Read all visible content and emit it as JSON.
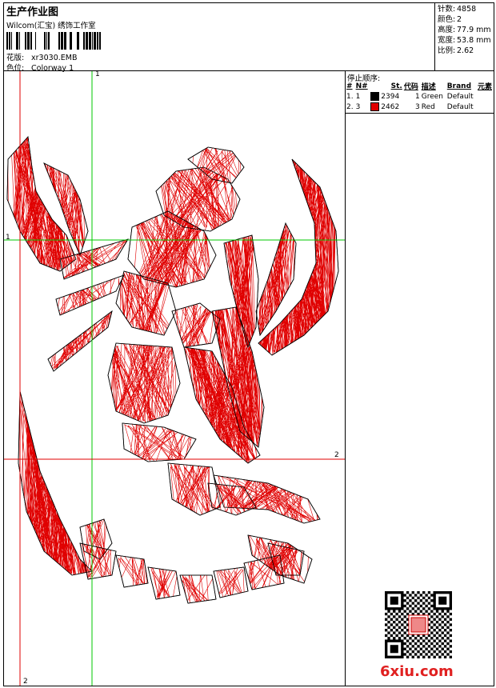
{
  "header": {
    "title": "生产作业图",
    "subtitle": "Wilcom(汇宝) 绣饰工作室",
    "design_label": "花版:",
    "design_value": "xr3030.EMB",
    "colorway_label": "色位:",
    "colorway_value": "Colorway 1"
  },
  "stats": {
    "stitches_label": "针数:",
    "stitches_value": "4858",
    "colors_label": "颜色:",
    "colors_value": "2",
    "height_label": "高度:",
    "height_value": "77.9 mm",
    "width_label": "宽度:",
    "width_value": "53.8 mm",
    "scale_label": "比例:",
    "scale_value": "2.62"
  },
  "stop_sequence": {
    "title": "停止顺序:",
    "columns": [
      "#",
      "N#",
      "St.",
      "代码",
      "描述",
      "Brand",
      "元素"
    ],
    "rows": [
      {
        "index": "1.",
        "needle": "1",
        "stitches": "2394",
        "code": "1",
        "description": "Green",
        "brand": "Default",
        "color": "#000000"
      },
      {
        "index": "2.",
        "needle": "3",
        "stitches": "2462",
        "code": "3",
        "description": "Red",
        "brand": "Default",
        "color": "#e00000"
      }
    ]
  },
  "guides": {
    "v1_label": "1",
    "h1_label": "1",
    "h2_label": "2",
    "v2_label": "2"
  },
  "colors": {
    "guide_green": "#00c800",
    "guide_red": "#e00000",
    "stitch_red": "#e00000",
    "outline": "#000000"
  },
  "watermark": {
    "site": "6xiu.com"
  }
}
